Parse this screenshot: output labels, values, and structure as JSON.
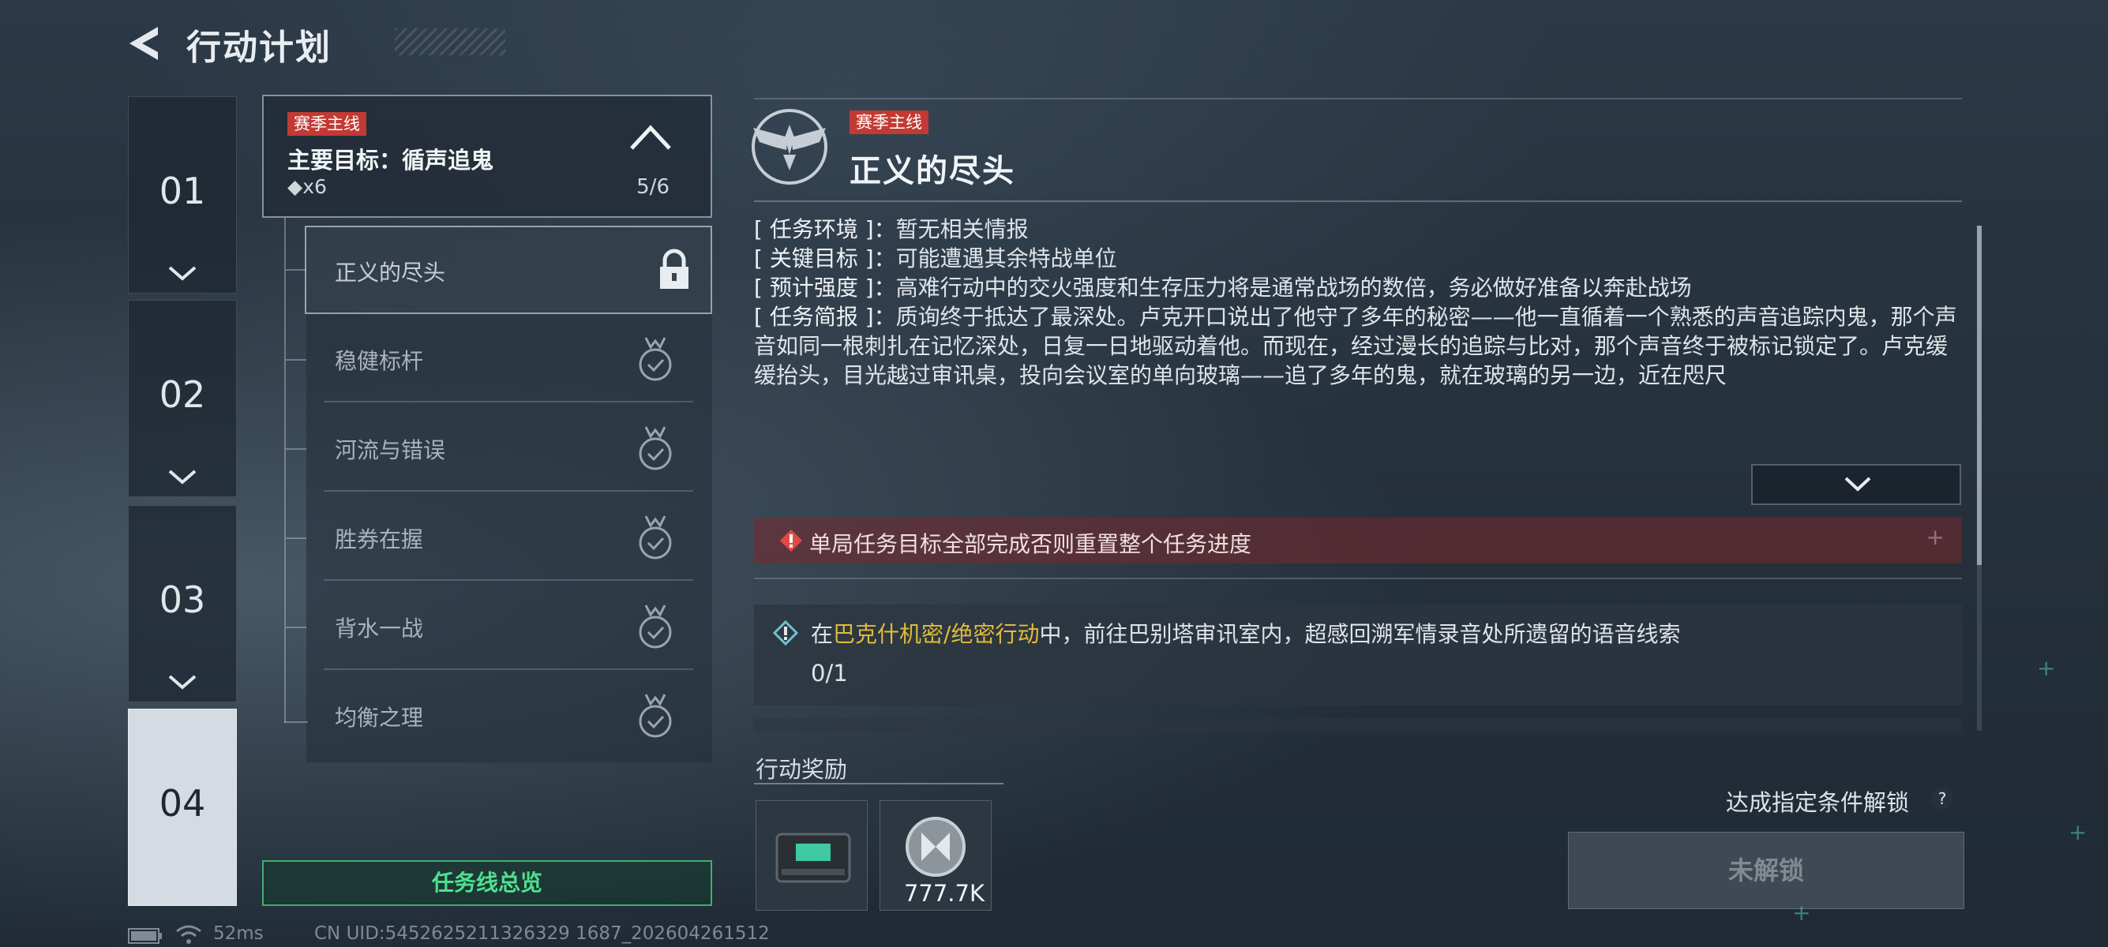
{
  "header": {
    "title": "行动计划"
  },
  "chapters": [
    {
      "label": "01",
      "active": false
    },
    {
      "label": "02",
      "active": false
    },
    {
      "label": "03",
      "active": false
    },
    {
      "label": "04",
      "active": true
    }
  ],
  "task_header": {
    "tag": "赛季主线",
    "objective": "主要目标：循声追鬼",
    "reward": "◆x6",
    "progress": "5/6"
  },
  "subtasks": [
    {
      "label": "正义的尽头",
      "status": "locked"
    },
    {
      "label": "稳健标杆",
      "status": "completed"
    },
    {
      "label": "河流与错误",
      "status": "completed"
    },
    {
      "label": "胜券在握",
      "status": "completed"
    },
    {
      "label": "背水一战",
      "status": "completed"
    },
    {
      "label": "均衡之理",
      "status": "completed"
    }
  ],
  "overview_button": "任务线总览",
  "status_bar": {
    "ping": "52ms",
    "uid": "CN UID:5452625211326329 1687_202604261512"
  },
  "mission": {
    "tag": "赛季主线",
    "title": "正义的尽头",
    "env_key": "[ 任务环境 ]：",
    "env_val": "暂无相关情报",
    "target_key": "[ 关键目标 ]：",
    "target_val": "可能遭遇其余特战单位",
    "intensity_key": "[ 预计强度 ]：",
    "intensity_val": "高难行动中的交火强度和生存压力将是通常战场的数倍，务必做好准备以奔赴战场",
    "brief_key": "[ 任务简报 ]：",
    "brief_val": "质询终于抵达了最深处。卢克开口说出了他守了多年的秘密——他一直循着一个熟悉的声音追踪内鬼，那个声音如同一根刺扎在记忆深处，日复一日地驱动着他。而现在，经过漫长的追踪与比对，那个声音终于被标记锁定了。卢克缓缓抬头，目光越过审讯桌，投向会议室的单向玻璃——追了多年的鬼，就在玻璃的另一边，近在咫尺"
  },
  "warning": "单局任务目标全部完成否则重置整个任务进度",
  "objective": {
    "prefix": "在",
    "highlight": "巴克什机密/绝密行动",
    "suffix": "中，前往巴别塔审讯室内，超感回溯军情录音处所遗留的语音线索",
    "progress": "0/1"
  },
  "rewards": {
    "label": "行动奖励",
    "items": [
      {
        "icon": "supply-box-icon",
        "count": ""
      },
      {
        "icon": "silver-coin-icon",
        "count": "777.7K"
      }
    ]
  },
  "unlock": {
    "hint": "达成指定条件解锁",
    "help": "?",
    "button": "未解锁"
  },
  "colors": {
    "accent_green": "#4fe08f",
    "tag_red": "#c23a33",
    "highlight_gold": "#e2bb3a"
  }
}
